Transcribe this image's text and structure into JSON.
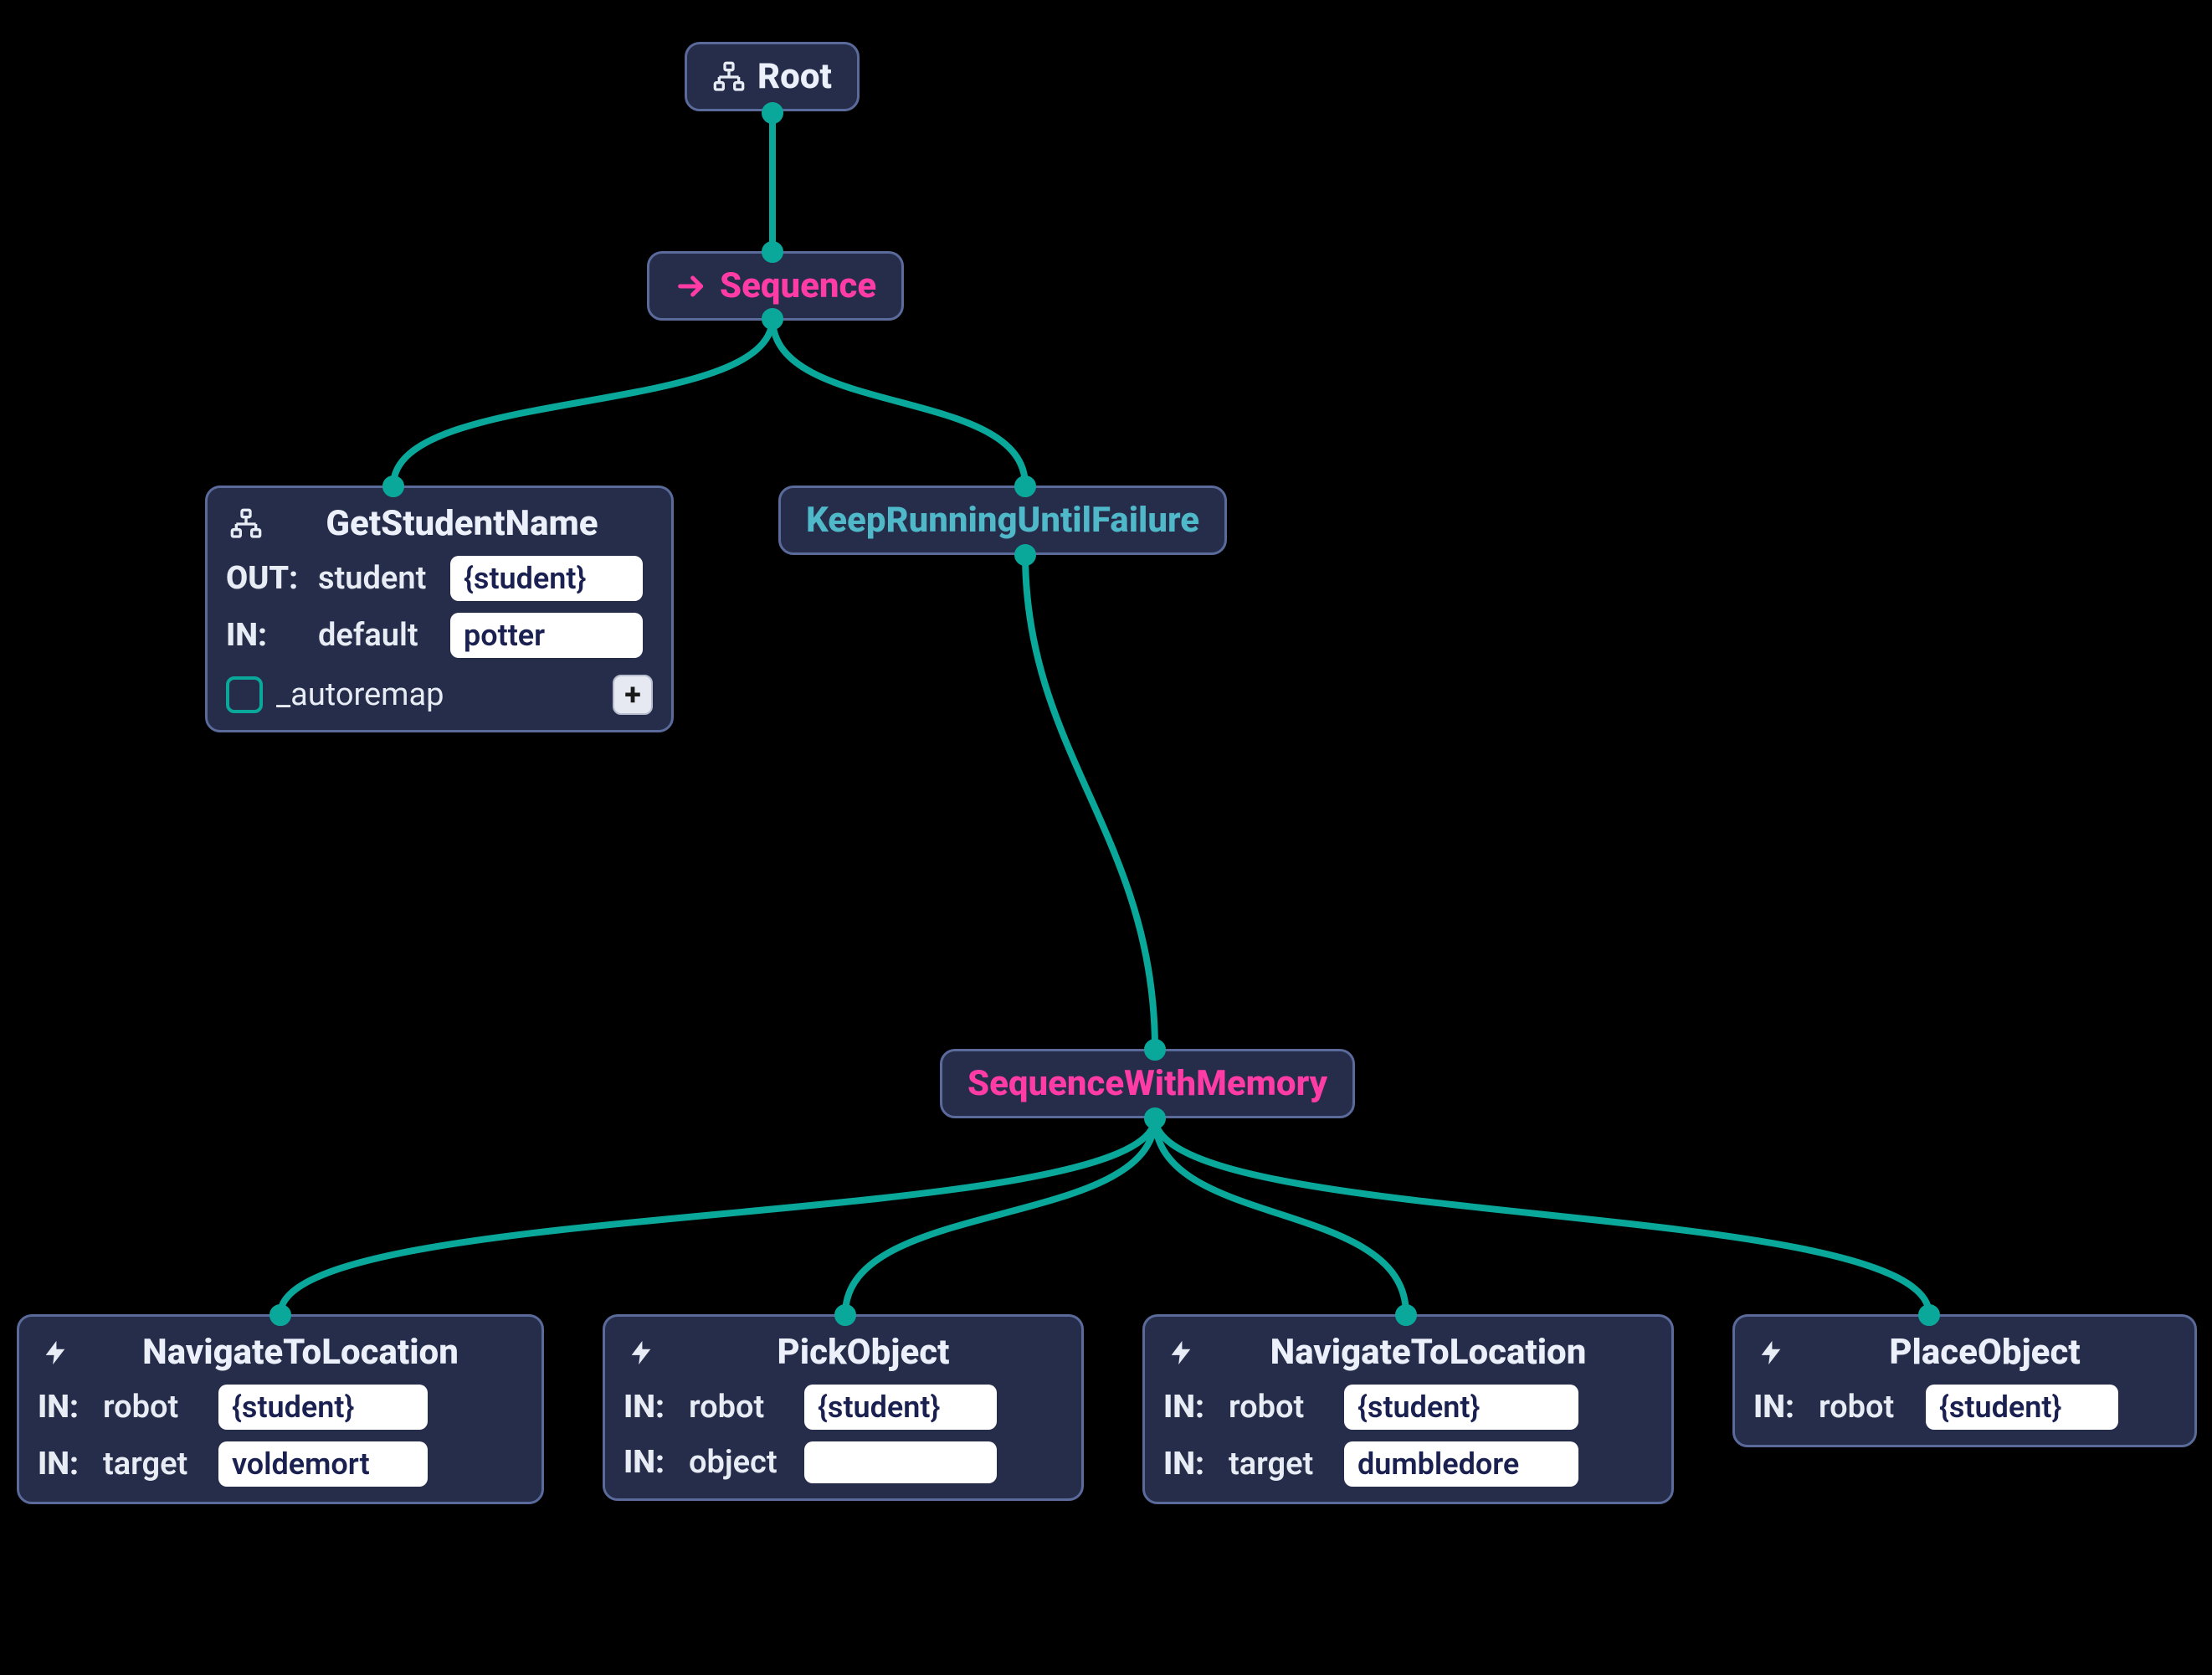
{
  "colors": {
    "edge": "#0aa89a",
    "node_bg": "#262d4a",
    "node_border": "#5a6a9a",
    "title_white": "#ecf0fa",
    "title_pink": "#ff3ca6",
    "title_teal": "#4fb8c9"
  },
  "nodes": {
    "root": {
      "label": "Root",
      "title_color": "white",
      "icon": "tree"
    },
    "seq": {
      "label": "Sequence",
      "title_color": "pink",
      "icon": "arrow-right"
    },
    "getstu": {
      "label": "GetStudentName",
      "title_color": "white",
      "icon": "tree",
      "ports": [
        {
          "dir": "OUT:",
          "key": "student",
          "value": "{student}"
        },
        {
          "dir": "IN:",
          "key": "default",
          "value": "potter"
        }
      ],
      "autoremap_label": "_autoremap",
      "add_label": "+"
    },
    "keep": {
      "label": "KeepRunningUntilFailure",
      "title_color": "teal",
      "icon": null
    },
    "seqmem": {
      "label": "SequenceWithMemory",
      "title_color": "pink",
      "icon": null
    },
    "nav1": {
      "label": "NavigateToLocation",
      "title_color": "white",
      "icon": "bolt",
      "ports": [
        {
          "dir": "IN:",
          "key": "robot",
          "value": "{student}"
        },
        {
          "dir": "IN:",
          "key": "target",
          "value": "voldemort"
        }
      ]
    },
    "pick": {
      "label": "PickObject",
      "title_color": "white",
      "icon": "bolt",
      "ports": [
        {
          "dir": "IN:",
          "key": "robot",
          "value": "{student}"
        },
        {
          "dir": "IN:",
          "key": "object",
          "value": ""
        }
      ]
    },
    "nav2": {
      "label": "NavigateToLocation",
      "title_color": "white",
      "icon": "bolt",
      "ports": [
        {
          "dir": "IN:",
          "key": "robot",
          "value": "{student}"
        },
        {
          "dir": "IN:",
          "key": "target",
          "value": "dumbledore"
        }
      ]
    },
    "place": {
      "label": "PlaceObject",
      "title_color": "white",
      "icon": "bolt",
      "ports": [
        {
          "dir": "IN:",
          "key": "robot",
          "value": "{student}"
        }
      ]
    }
  },
  "edges": [
    {
      "from": "root",
      "to": "seq"
    },
    {
      "from": "seq",
      "to": "getstu"
    },
    {
      "from": "seq",
      "to": "keep"
    },
    {
      "from": "keep",
      "to": "seqmem"
    },
    {
      "from": "seqmem",
      "to": "nav1"
    },
    {
      "from": "seqmem",
      "to": "pick"
    },
    {
      "from": "seqmem",
      "to": "nav2"
    },
    {
      "from": "seqmem",
      "to": "place"
    }
  ]
}
